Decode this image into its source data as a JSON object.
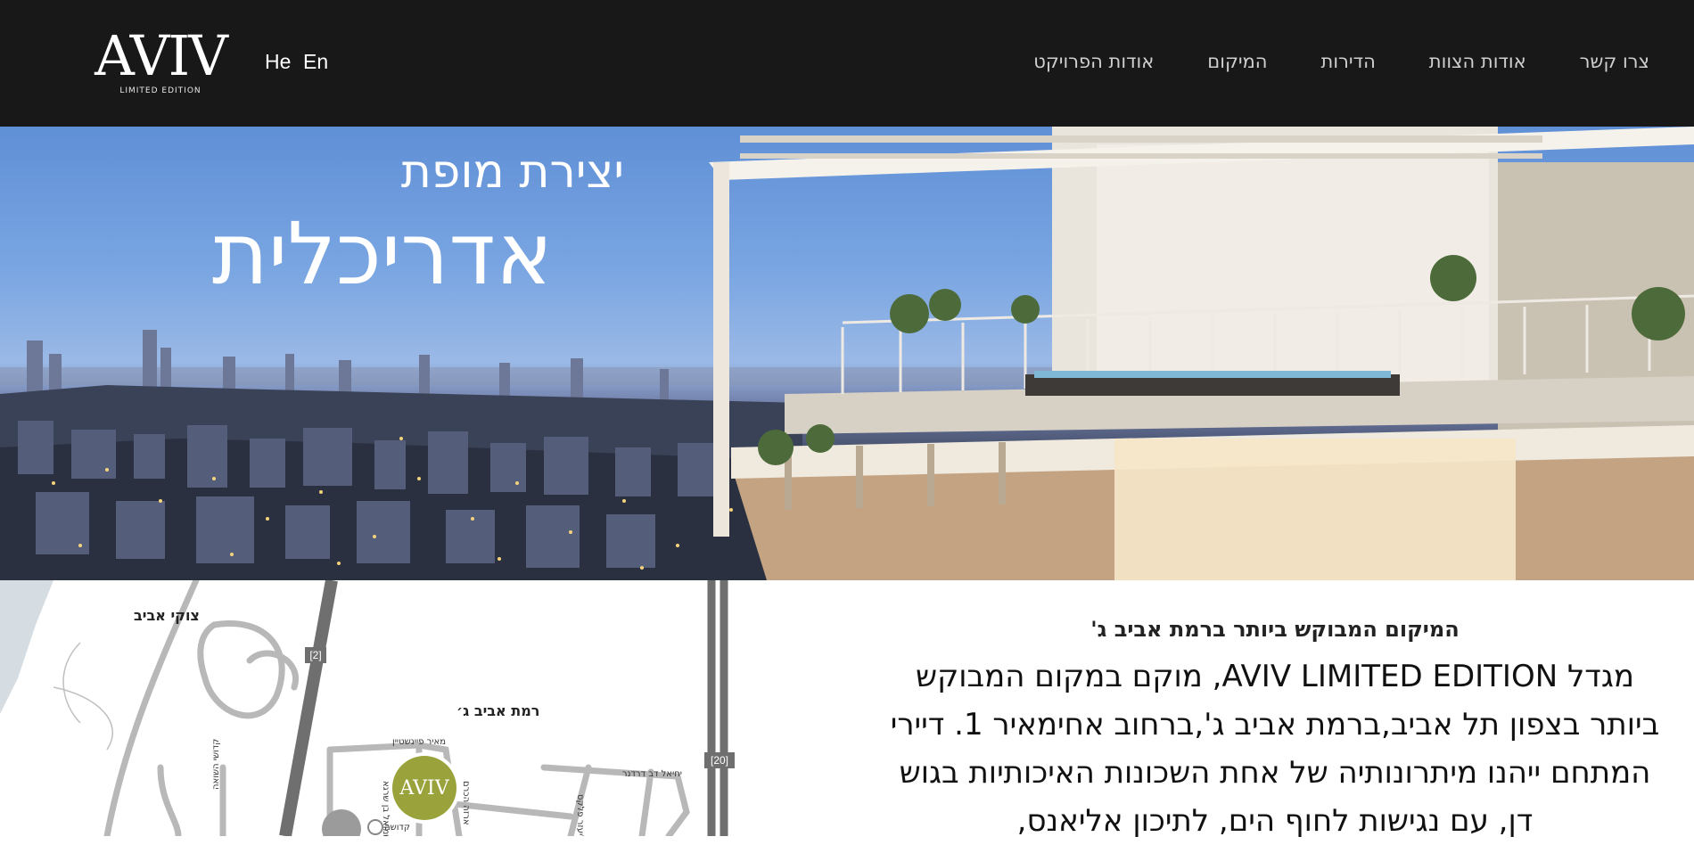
{
  "header": {
    "logo": {
      "main": "AVIV",
      "sub": "LIMITED EDITION"
    },
    "lang": {
      "he": "He",
      "en": "En"
    },
    "nav": [
      {
        "label": "אודות הפרויקט"
      },
      {
        "label": "המיקום"
      },
      {
        "label": "הדירות"
      },
      {
        "label": "אודות הצוות"
      },
      {
        "label": "צרו קשר"
      }
    ]
  },
  "hero": {
    "title_small": "יצירת מופת",
    "title_big": "אדריכלית"
  },
  "map": {
    "area_label": "רמת אביב ג׳",
    "tzuki_label": "צוקי אביב",
    "road_2": "[2]",
    "road_20": "[20]",
    "street_1": "מאיר פיינשטיין",
    "street_2": "קדושי השואה",
    "street_3": "יחיאל דב דרדנר",
    "street_4": "אליעזר פלקס",
    "street_5": "ארזה הכרם",
    "street_6": "שמואל בן שרגא",
    "street_7": "קדושה בן",
    "marker_logo": "AVIV"
  },
  "content": {
    "subhead": "המיקום המבוקש ביותר ברמת אביב ג'",
    "paragraph": "מגדל AVIV LIMITED EDITION, מוקם במקום המבוקש ביותר בצפון תל אביב,ברמת אביב ג',ברחוב אחימאיר 1. דיירי המתחם ייהנו מיתרונותיה של אחת השכונות האיכותיות בגוש דן, עם נגישות לחוף הים, לתיכון אליאנס,"
  }
}
